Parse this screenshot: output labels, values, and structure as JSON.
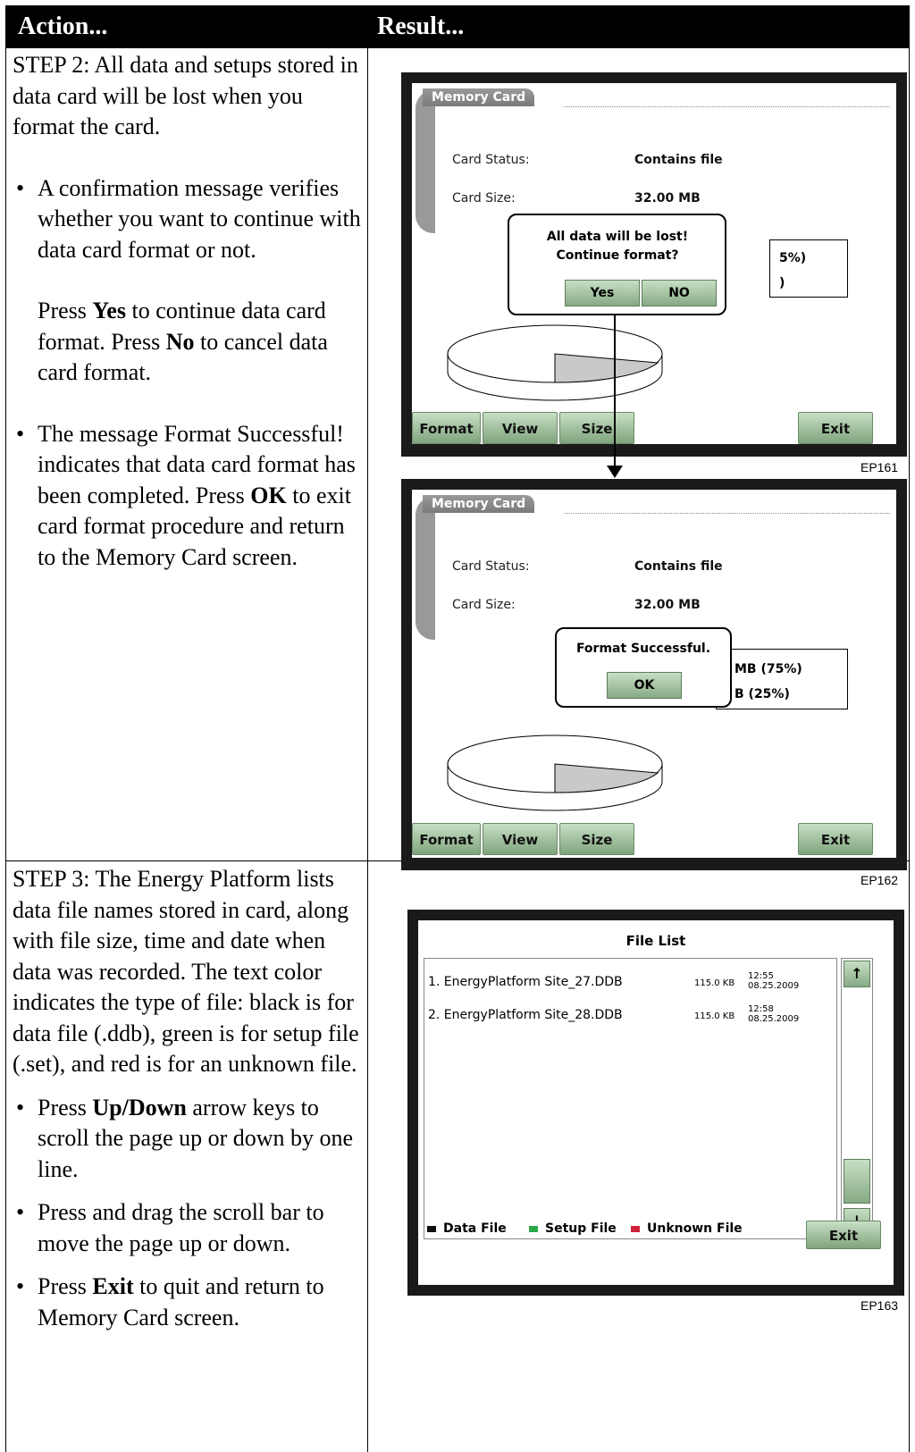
{
  "header": {
    "action": "Action...",
    "result": "Result..."
  },
  "step2": {
    "intro": "STEP 2: All data and setups stored in data card will be lost when you format the card.",
    "bullet1": "A confirmation message verifies whether you want to continue with data card format or not.",
    "press": "Press",
    "yes": "Yes",
    "mid": "to continue data card format. Press",
    "no": "No",
    "tail": "to cancel data card format.",
    "bullet2_pre": "The message Format Successful! indicates that data card format has been completed. Press",
    "ok": "OK",
    "bullet2_post": "to exit card format procedure and return to the Memory Card screen."
  },
  "step3": {
    "intro": "STEP 3: The Energy Platform lists data file names stored in card, along with file size, time and date when data was recorded. The text color indicates the type of file: black is for data file (.ddb), green is for setup file (.set), and red is for an unknown file.",
    "b1_pre": "Press",
    "b1_bold": "Up/Down",
    "b1_post": "arrow keys to scroll the page up or down by one line.",
    "b2": "Press and drag the scroll bar to move the page up or down.",
    "b3_pre": "Press",
    "b3_bold": "Exit",
    "b3_post": "to quit and return to Memory Card screen."
  },
  "screen1": {
    "tab": "Memory Card",
    "status_label": "Card Status:",
    "status_value": "Contains file",
    "size_label": "Card Size:",
    "size_value": "32.00 MB",
    "dialog_text": "All data will be lost! Continue format?",
    "yes_button": "Yes",
    "no_button": "NO",
    "partial1": "5%)",
    "partial2": ")",
    "buttons": {
      "format": "Format",
      "view": "View",
      "size": "Size",
      "exit": "Exit"
    },
    "caption": "EP161"
  },
  "screen2": {
    "tab": "Memory Card",
    "status_label": "Card Status:",
    "status_value": "Contains file",
    "size_label": "Card Size:",
    "size_value": "32.00 MB",
    "dialog_text": "Format Successful.",
    "ok_button": "OK",
    "partial1": "MB (75%)",
    "partial2": "B (25%)",
    "buttons": {
      "format": "Format",
      "view": "View",
      "size": "Size",
      "exit": "Exit"
    },
    "caption": "EP162"
  },
  "screen3": {
    "title": "File List",
    "files": [
      {
        "name": "1. EnergyPlatform Site_27.DDB",
        "size": "115.0 KB",
        "time": "12:55",
        "date": "08.25.2009"
      },
      {
        "name": "2. EnergyPlatform Site_28.DDB",
        "size": "115.0 KB",
        "time": "12:58",
        "date": "08.25.2009"
      }
    ],
    "up_arrow": "↑",
    "down_arrow": "↓",
    "legend": {
      "data": "Data File",
      "setup": "Setup File",
      "unknown": "Unknown File"
    },
    "colors": {
      "data": "#111111",
      "setup": "#2aa84a",
      "unknown": "#d0213a"
    },
    "exit": "Exit",
    "caption": "EP163"
  }
}
